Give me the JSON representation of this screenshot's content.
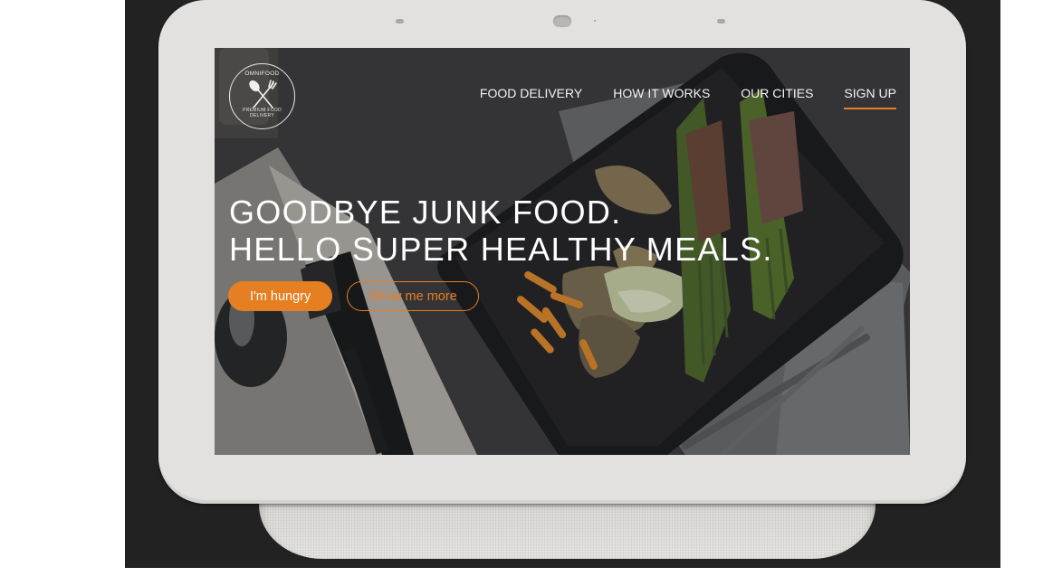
{
  "logo": {
    "top_text": "OMNIFOOD",
    "bottom_text": "PREMIUM FOOD DELIVERY"
  },
  "nav": {
    "items": [
      {
        "label": "FOOD DELIVERY"
      },
      {
        "label": "HOW IT WORKS"
      },
      {
        "label": "OUR CITIES"
      },
      {
        "label": "SIGN UP"
      }
    ]
  },
  "hero": {
    "headline_line1": "GOODBYE JUNK FOOD.",
    "headline_line2": "HELLO SUPER HEALTHY MEALS.",
    "primary_button": "I'm hungry",
    "secondary_button": "Show me more"
  },
  "colors": {
    "accent": "#e67e22",
    "text": "#ffffff",
    "bezel": "#e2e1df",
    "backdrop": "#222223"
  },
  "icons": {
    "logo": "fork-and-spoon-icon"
  }
}
